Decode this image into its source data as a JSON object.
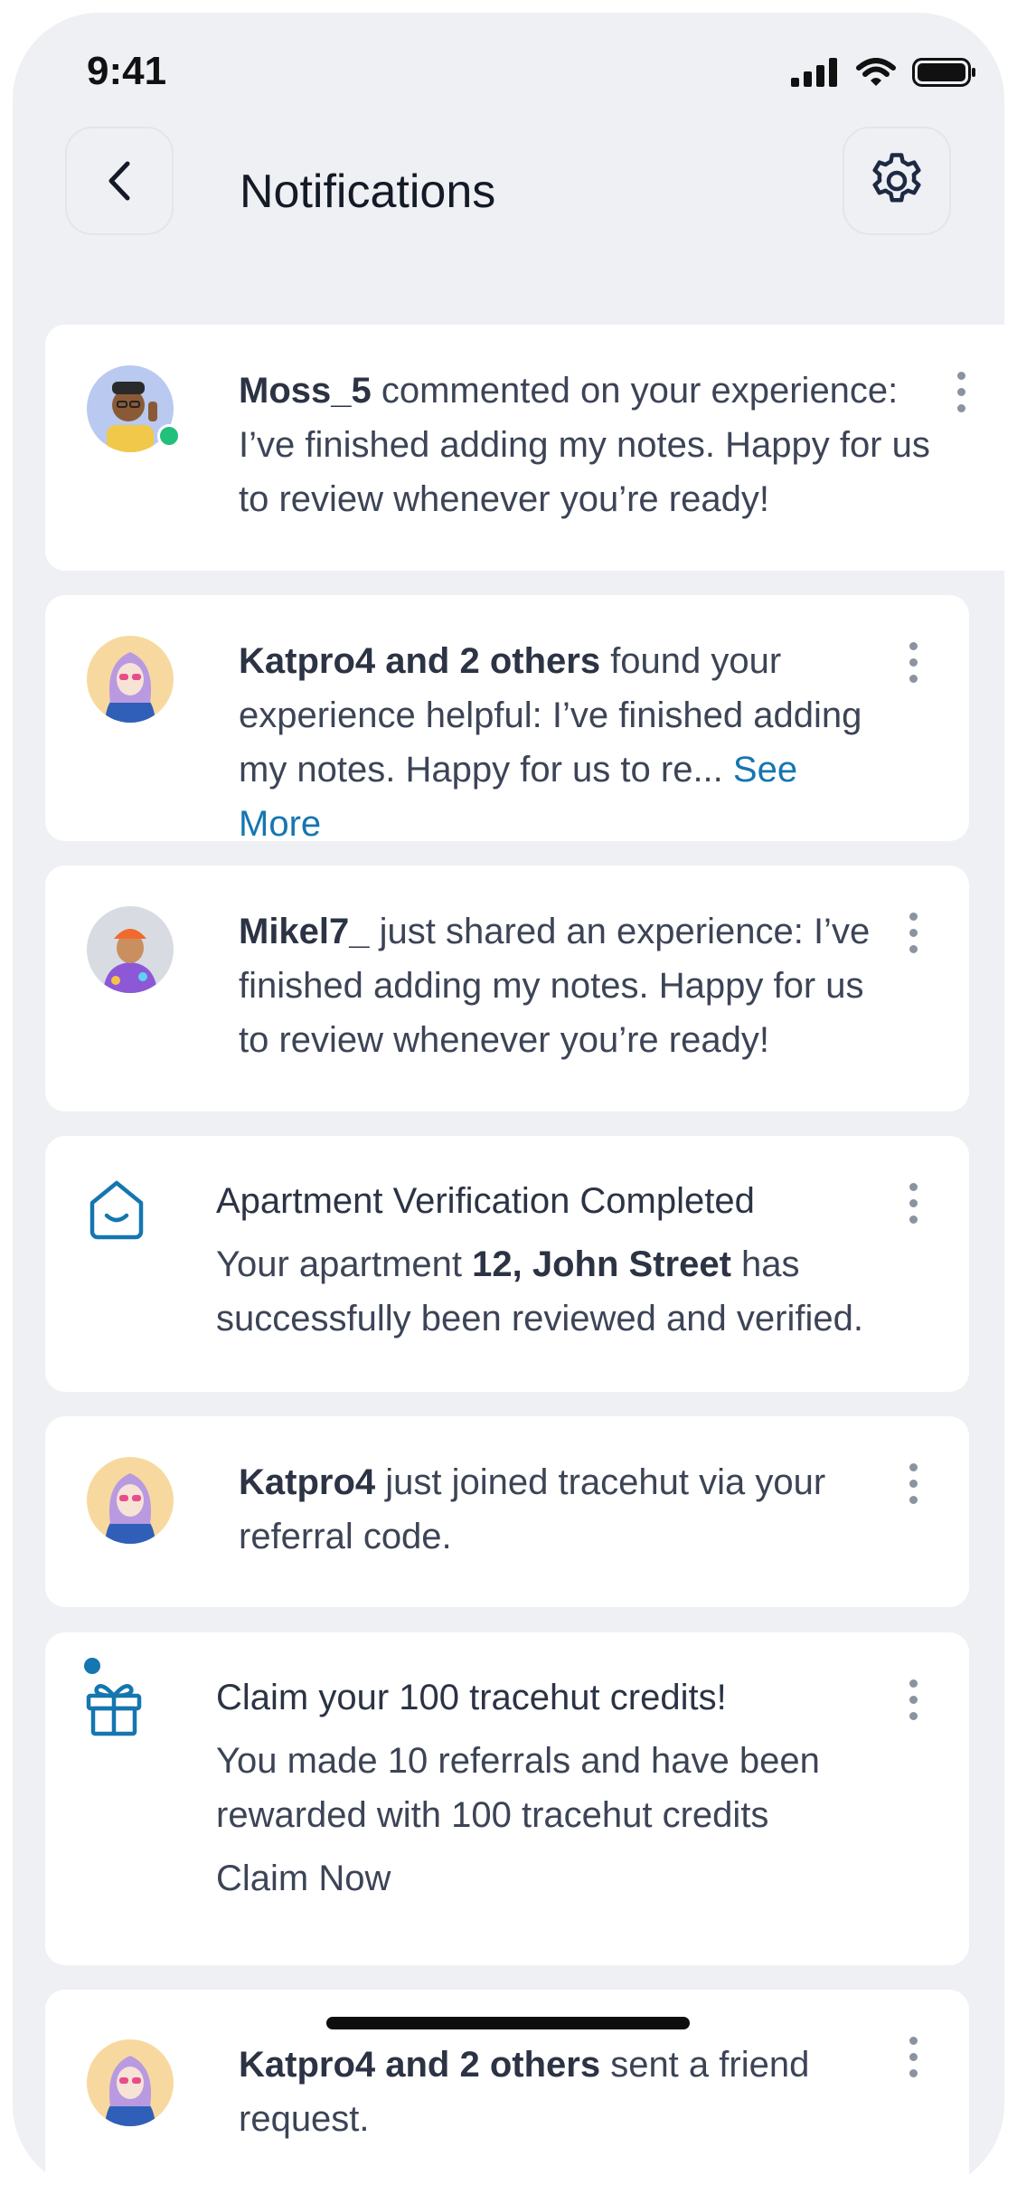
{
  "status_bar": {
    "time": "9:41"
  },
  "header": {
    "title": "Notifications"
  },
  "notifications": [
    {
      "user": "Moss_5",
      "text": " commented on your experience: I’ve finished adding my notes. Happy for us to review whenever you’re ready!"
    },
    {
      "user": "Katpro4 and 2 others",
      "text": " found your experience helpful: I’ve finished adding my notes. Happy for us to re... ",
      "link": "See More"
    },
    {
      "user": "Mikel7_",
      "text": " just shared an experience: I’ve finished adding my notes. Happy for us to review whenever you’re ready!"
    },
    {
      "title": "Apartment Verification Completed",
      "text_before": "Your apartment ",
      "highlight": "12, John Street",
      "text_after": " has successfully been reviewed and verified."
    },
    {
      "user": "Katpro4",
      "text": " just joined tracehut via your referral code."
    },
    {
      "title": "Claim your 100 tracehut credits!",
      "text": "You made 10 referrals and have been rewarded with 100 tracehut credits",
      "link": "Claim Now"
    },
    {
      "user": "Katpro4 and 2 others",
      "text": " sent a friend request."
    }
  ],
  "colors": {
    "accent": "#1576b0",
    "online": "#22c07a",
    "background": "#eef0f4"
  }
}
